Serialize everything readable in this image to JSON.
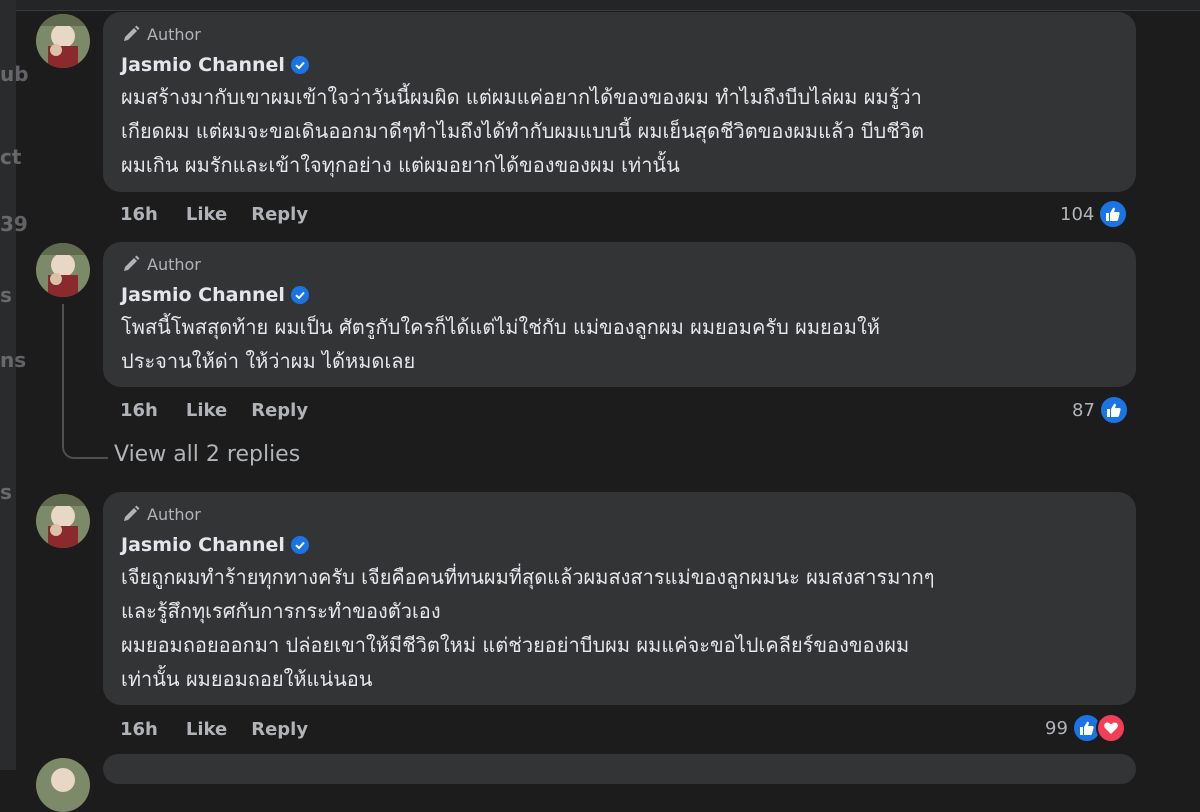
{
  "left_strip": {
    "fragments": [
      "ub",
      "ct",
      "39",
      "s",
      "ns",
      "s"
    ]
  },
  "comments": [
    {
      "badge": "Author",
      "author": "Jasmio Channel",
      "text": "ผมสร้างมากับเขาผมเข้าใจว่าวันนี้ผมผิด แต่ผมแค่อยากได้ของของผม ทำไมถึงบีบไล่ผม ผมรู้ว่า\nเกียดผม แต่ผมจะขอเดินออกมาดีๆทำไมถึงได้ทำกับผมแบบนี้ ผมเย็นสุดชีวิตของผมแล้ว บีบชีวิต\nผมเกิน ผมรักและเข้าใจทุกอย่าง แต่ผมอยากได้ของของผม เท่านั้น",
      "time": "16h",
      "like_label": "Like",
      "reply_label": "Reply",
      "reaction_count": "104",
      "reactions": [
        "like"
      ]
    },
    {
      "badge": "Author",
      "author": "Jasmio Channel",
      "text": "โพสนี้โพสสุดท้าย ผมเป็น ศัตรูกับใครก็ได้แต่ไม่ใช่กับ แม่ของลูกผม ผมยอมครับ ผมยอมให้\nประจานให้ด่า ให้ว่าผม ได้หมดเลย",
      "time": "16h",
      "like_label": "Like",
      "reply_label": "Reply",
      "reaction_count": "87",
      "reactions": [
        "like"
      ]
    },
    {
      "badge": "Author",
      "author": "Jasmio Channel",
      "text": "เจียถูกผมทำร้ายทุกทางครับ เจียคือคนที่ทนผมที่สุดแล้วผมสงสารแม่ของลูกผมนะ ผมสงสารมากๆ\nและรู้สึกทุเรศกับการกระทำของตัวเอง\nผมยอมถอยออกมา ปล่อยเขาให้มีชีวิตใหม่ แต่ช่วยอย่าบีบผม ผมแค่จะขอไปเคลียร์ของของผม\nเท่านั้น ผมยอมถอยให้แน่นอน",
      "time": "16h",
      "like_label": "Like",
      "reply_label": "Reply",
      "reaction_count": "99",
      "reactions": [
        "like",
        "love"
      ]
    }
  ],
  "view_replies_label": "View all 2 replies",
  "colors": {
    "background": "#1c1c1d",
    "bubble": "#333436",
    "like_blue": "#1b74e4",
    "love_red": "#f33e58",
    "verified_blue": "#1b74e4",
    "muted_text": "#b0b3b8"
  },
  "icons": [
    "pencil-icon",
    "verified-badge-icon",
    "like-reaction-icon",
    "love-reaction-icon"
  ]
}
